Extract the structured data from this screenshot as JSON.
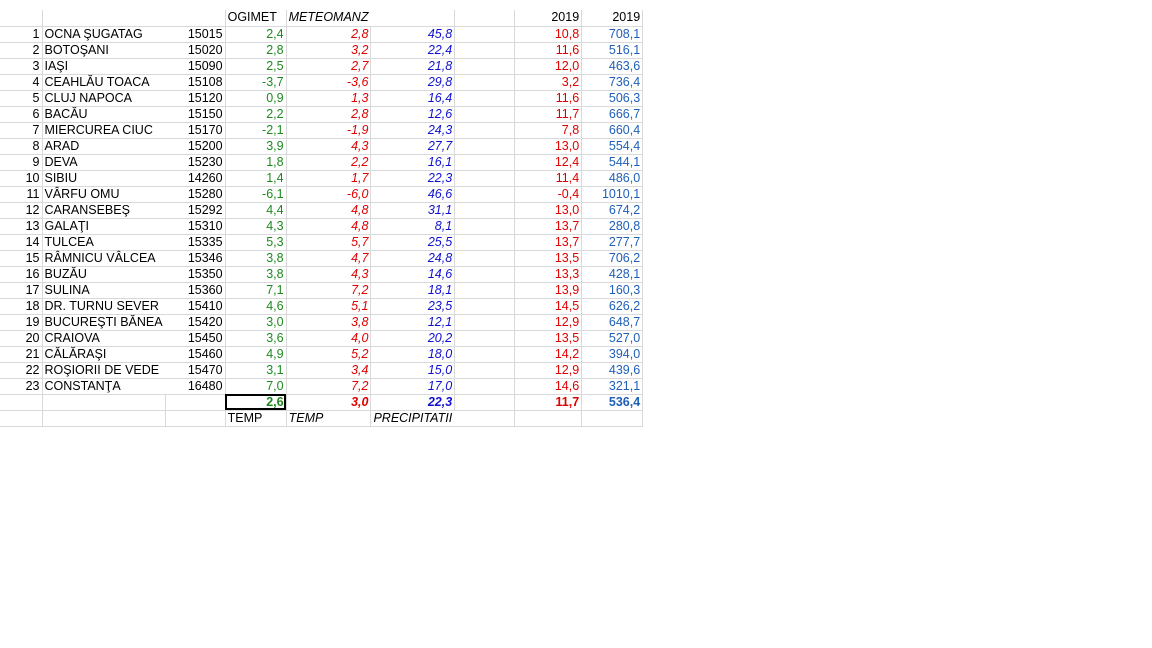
{
  "header": {
    "ogimet": "OGIMET",
    "meteomanz": "METEOMANZ",
    "year_a": "2019",
    "year_b": "2019"
  },
  "rows": [
    {
      "n": "1",
      "name": "OCNA ŞUGATAG",
      "code": "15015",
      "t1": "2,4",
      "t2": "2,8",
      "p": "45,8",
      "t3": "10,8",
      "p2": "708,1"
    },
    {
      "n": "2",
      "name": "BOTOŞANI",
      "code": "15020",
      "t1": "2,8",
      "t2": "3,2",
      "p": "22,4",
      "t3": "11,6",
      "p2": "516,1"
    },
    {
      "n": "3",
      "name": "IAŞI",
      "code": "15090",
      "t1": "2,5",
      "t2": "2,7",
      "p": "21,8",
      "t3": "12,0",
      "p2": "463,6"
    },
    {
      "n": "4",
      "name": "CEAHLĂU TOACA",
      "code": "15108",
      "t1": "-3,7",
      "t2": "-3,6",
      "p": "29,8",
      "t3": "3,2",
      "p2": "736,4"
    },
    {
      "n": "5",
      "name": "CLUJ NAPOCA",
      "code": "15120",
      "t1": "0,9",
      "t2": "1,3",
      "p": "16,4",
      "t3": "11,6",
      "p2": "506,3"
    },
    {
      "n": "6",
      "name": "BACĂU",
      "code": "15150",
      "t1": "2,2",
      "t2": "2,8",
      "p": "12,6",
      "t3": "11,7",
      "p2": "666,7"
    },
    {
      "n": "7",
      "name": "MIERCUREA CIUC",
      "code": "15170",
      "t1": "-2,1",
      "t2": "-1,9",
      "p": "24,3",
      "t3": "7,8",
      "p2": "660,4"
    },
    {
      "n": "8",
      "name": "ARAD",
      "code": "15200",
      "t1": "3,9",
      "t2": "4,3",
      "p": "27,7",
      "t3": "13,0",
      "p2": "554,4"
    },
    {
      "n": "9",
      "name": "DEVA",
      "code": "15230",
      "t1": "1,8",
      "t2": "2,2",
      "p": "16,1",
      "t3": "12,4",
      "p2": "544,1"
    },
    {
      "n": "10",
      "name": "SIBIU",
      "code": "14260",
      "t1": "1,4",
      "t2": "1,7",
      "p": "22,3",
      "t3": "11,4",
      "p2": "486,0"
    },
    {
      "n": "11",
      "name": "VÂRFU OMU",
      "code": "15280",
      "t1": "-6,1",
      "t2": "-6,0",
      "p": "46,6",
      "t3": "-0,4",
      "p2": "1010,1"
    },
    {
      "n": "12",
      "name": "CARANSEBEŞ",
      "code": "15292",
      "t1": "4,4",
      "t2": "4,8",
      "p": "31,1",
      "t3": "13,0",
      "p2": "674,2"
    },
    {
      "n": "13",
      "name": "GALAŢI",
      "code": "15310",
      "t1": "4,3",
      "t2": "4,8",
      "p": "8,1",
      "t3": "13,7",
      "p2": "280,8"
    },
    {
      "n": "14",
      "name": "TULCEA",
      "code": "15335",
      "t1": "5,3",
      "t2": "5,7",
      "p": "25,5",
      "t3": "13,7",
      "p2": "277,7"
    },
    {
      "n": "15",
      "name": "RÂMNICU VÂLCEA",
      "code": "15346",
      "t1": "3,8",
      "t2": "4,7",
      "p": "24,8",
      "t3": "13,5",
      "p2": "706,2"
    },
    {
      "n": "16",
      "name": "BUZĂU",
      "code": "15350",
      "t1": "3,8",
      "t2": "4,3",
      "p": "14,6",
      "t3": "13,3",
      "p2": "428,1"
    },
    {
      "n": "17",
      "name": "SULINA",
      "code": "15360",
      "t1": "7,1",
      "t2": "7,2",
      "p": "18,1",
      "t3": "13,9",
      "p2": "160,3"
    },
    {
      "n": "18",
      "name": "DR. TURNU SEVER",
      "code": "15410",
      "t1": "4,6",
      "t2": "5,1",
      "p": "23,5",
      "t3": "14,5",
      "p2": "626,2"
    },
    {
      "n": "19",
      "name": "BUCUREŞTI BĂNEA",
      "code": "15420",
      "t1": "3,0",
      "t2": "3,8",
      "p": "12,1",
      "t3": "12,9",
      "p2": "648,7"
    },
    {
      "n": "20",
      "name": "CRAIOVA",
      "code": "15450",
      "t1": "3,6",
      "t2": "4,0",
      "p": "20,2",
      "t3": "13,5",
      "p2": "527,0"
    },
    {
      "n": "21",
      "name": "CĂLĂRAŞI",
      "code": "15460",
      "t1": "4,9",
      "t2": "5,2",
      "p": "18,0",
      "t3": "14,2",
      "p2": "394,0"
    },
    {
      "n": "22",
      "name": "ROŞIORII DE VEDE",
      "code": "15470",
      "t1": "3,1",
      "t2": "3,4",
      "p": "15,0",
      "t3": "12,9",
      "p2": "439,6"
    },
    {
      "n": "23",
      "name": "CONSTANŢA",
      "code": "16480",
      "t1": "7,0",
      "t2": "7,2",
      "p": "17,0",
      "t3": "14,6",
      "p2": "321,1"
    }
  ],
  "totals": {
    "t1": "2,6",
    "t2": "3,0",
    "p": "22,3",
    "t3": "11,7",
    "p2": "536,4"
  },
  "footer": {
    "temp_a": "TEMP",
    "temp_b": "TEMP",
    "precip": "PRECIPITATII"
  },
  "colors": {
    "green": "#1e8a1e",
    "red": "#e00000",
    "blue": "#1010d0",
    "blue2": "#1f5fb8"
  }
}
